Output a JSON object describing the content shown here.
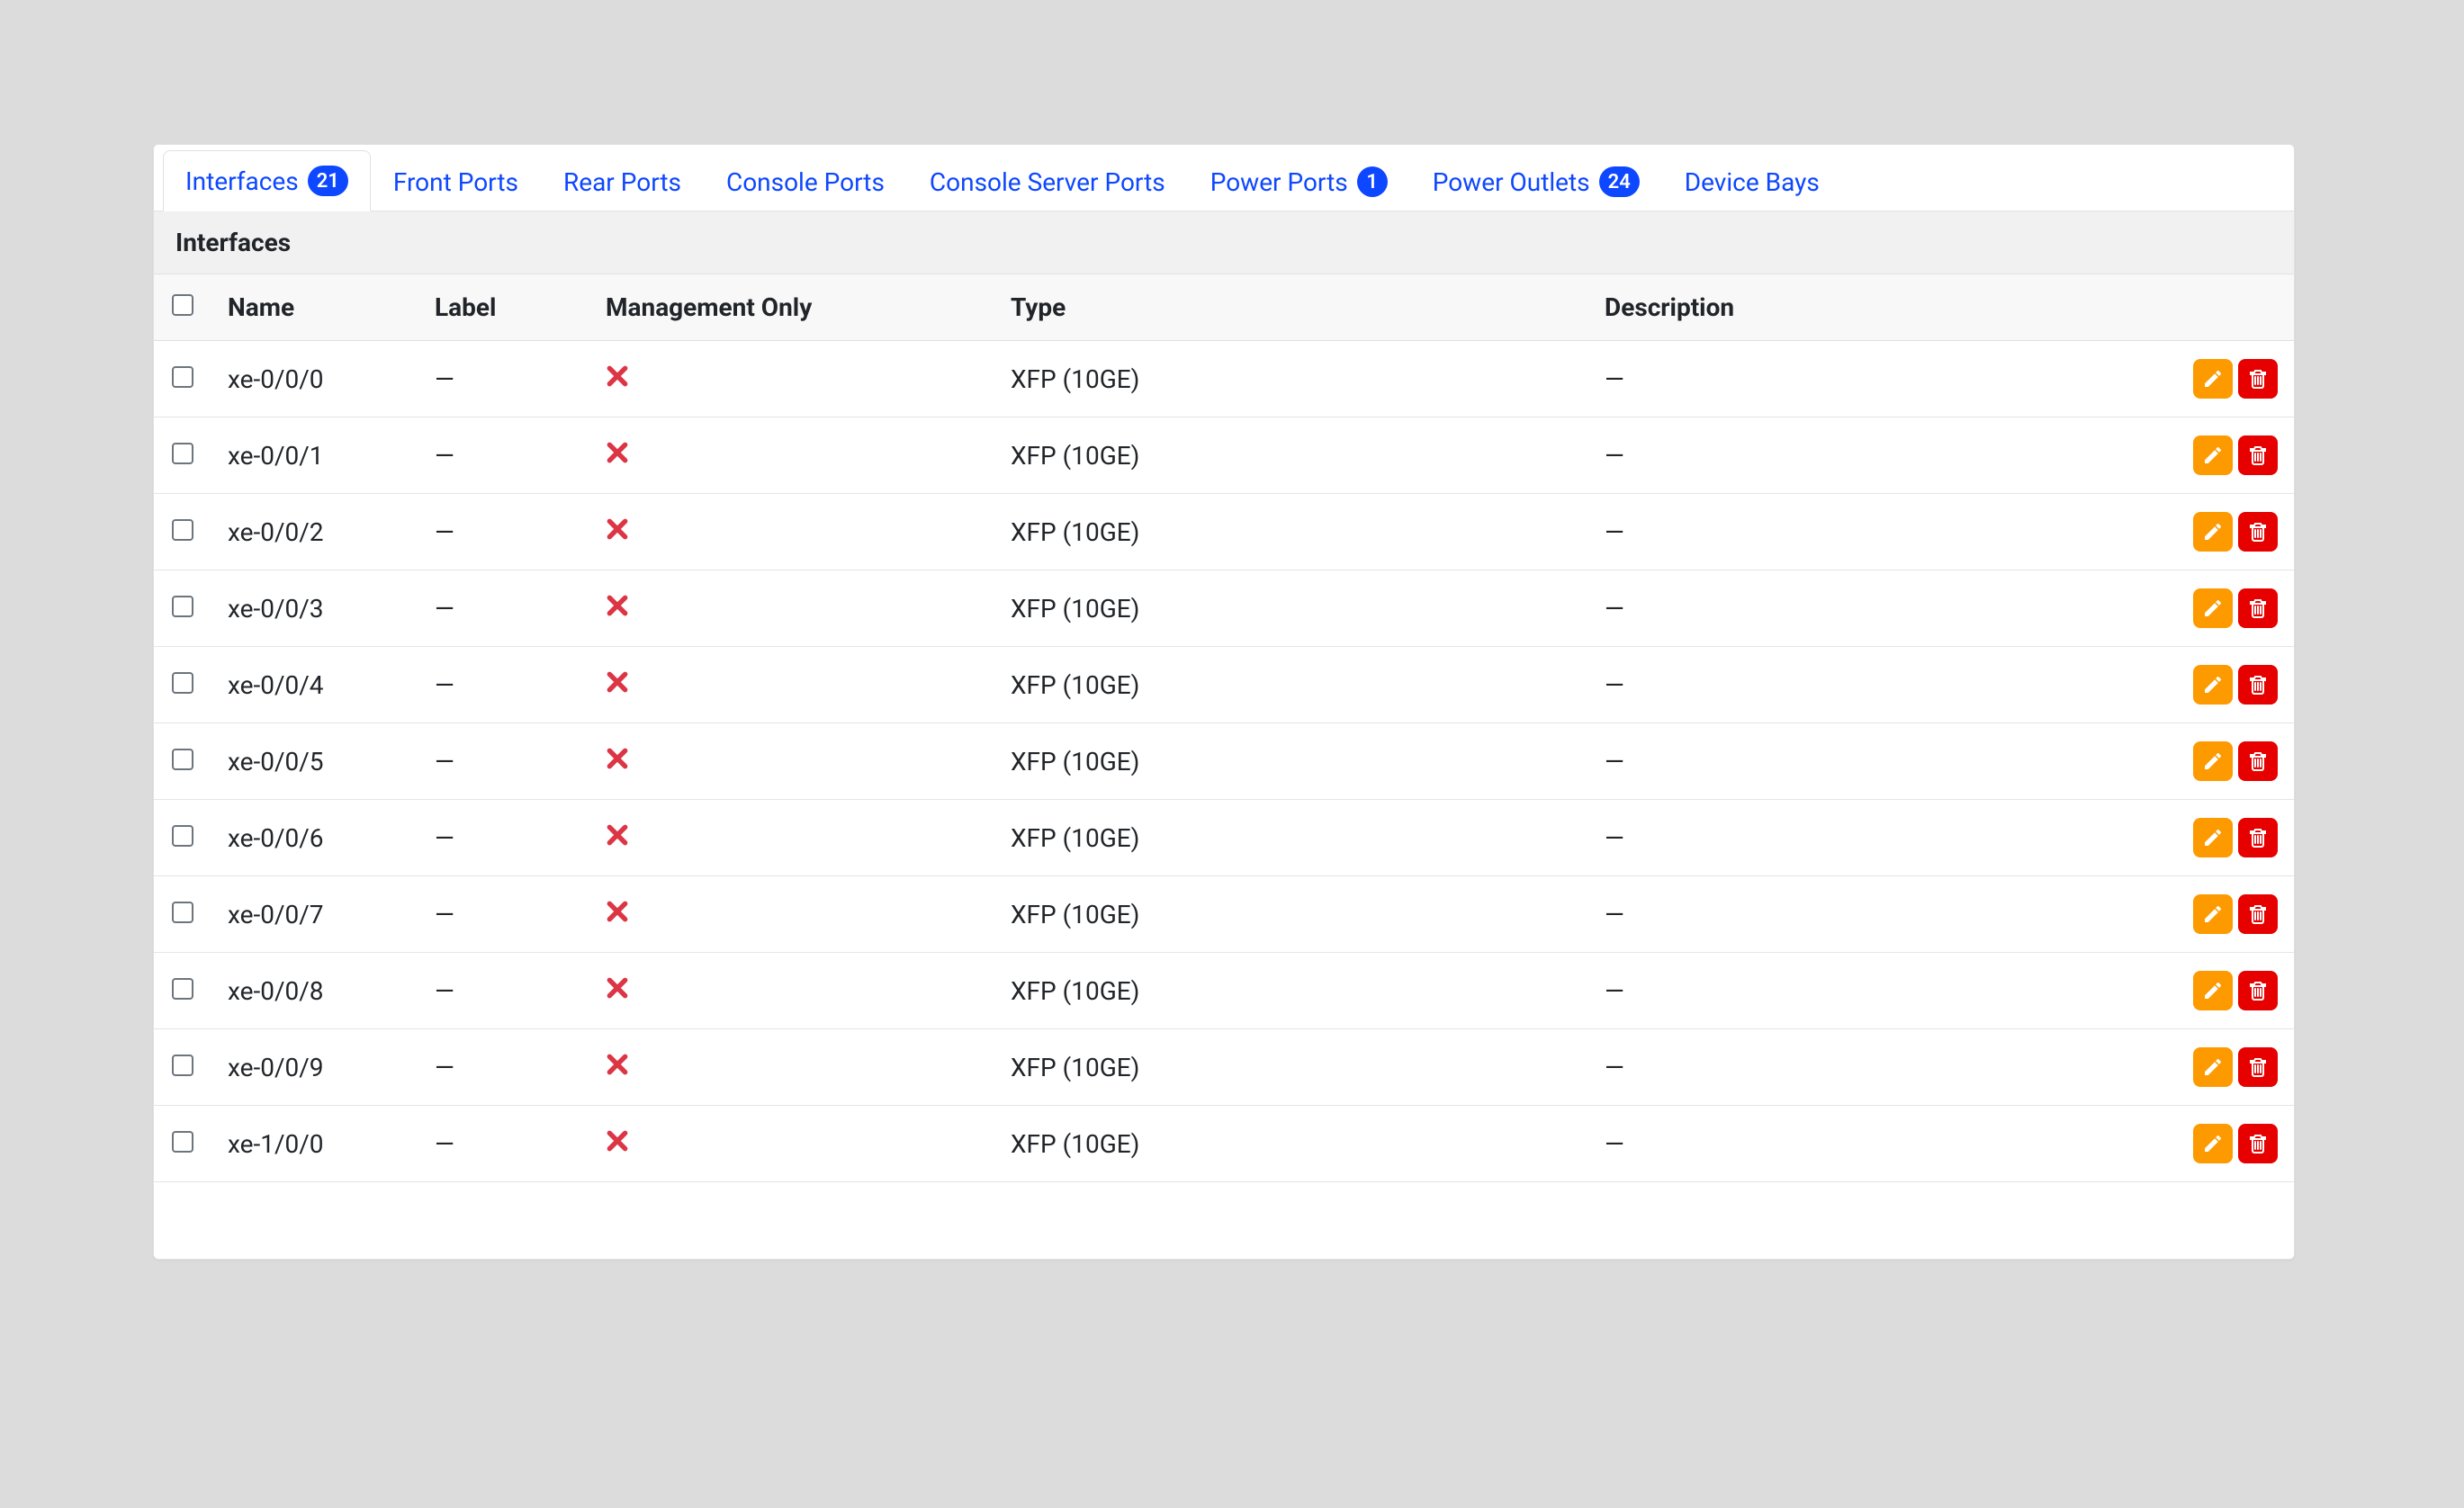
{
  "tabs": [
    {
      "label": "Interfaces",
      "badge": "21",
      "active": true
    },
    {
      "label": "Front Ports"
    },
    {
      "label": "Rear Ports"
    },
    {
      "label": "Console Ports"
    },
    {
      "label": "Console Server Ports"
    },
    {
      "label": "Power Ports",
      "badge": "1"
    },
    {
      "label": "Power Outlets",
      "badge": "24"
    },
    {
      "label": "Device Bays"
    }
  ],
  "card": {
    "title": "Interfaces"
  },
  "columns": [
    "Name",
    "Label",
    "Management Only",
    "Type",
    "Description"
  ],
  "empty_value": "—",
  "mgmt_only_false_icon": "cross-icon",
  "colors": {
    "primary": "#0d47ff",
    "edit": "#fd9a00",
    "delete": "#e60000",
    "cross": "#dc3545"
  },
  "rows": [
    {
      "name": "xe-0/0/0",
      "label": "—",
      "mgmt_only": false,
      "type": "XFP (10GE)",
      "description": "—"
    },
    {
      "name": "xe-0/0/1",
      "label": "—",
      "mgmt_only": false,
      "type": "XFP (10GE)",
      "description": "—"
    },
    {
      "name": "xe-0/0/2",
      "label": "—",
      "mgmt_only": false,
      "type": "XFP (10GE)",
      "description": "—"
    },
    {
      "name": "xe-0/0/3",
      "label": "—",
      "mgmt_only": false,
      "type": "XFP (10GE)",
      "description": "—"
    },
    {
      "name": "xe-0/0/4",
      "label": "—",
      "mgmt_only": false,
      "type": "XFP (10GE)",
      "description": "—"
    },
    {
      "name": "xe-0/0/5",
      "label": "—",
      "mgmt_only": false,
      "type": "XFP (10GE)",
      "description": "—"
    },
    {
      "name": "xe-0/0/6",
      "label": "—",
      "mgmt_only": false,
      "type": "XFP (10GE)",
      "description": "—"
    },
    {
      "name": "xe-0/0/7",
      "label": "—",
      "mgmt_only": false,
      "type": "XFP (10GE)",
      "description": "—"
    },
    {
      "name": "xe-0/0/8",
      "label": "—",
      "mgmt_only": false,
      "type": "XFP (10GE)",
      "description": "—"
    },
    {
      "name": "xe-0/0/9",
      "label": "—",
      "mgmt_only": false,
      "type": "XFP (10GE)",
      "description": "—"
    },
    {
      "name": "xe-1/0/0",
      "label": "—",
      "mgmt_only": false,
      "type": "XFP (10GE)",
      "description": "—"
    }
  ]
}
